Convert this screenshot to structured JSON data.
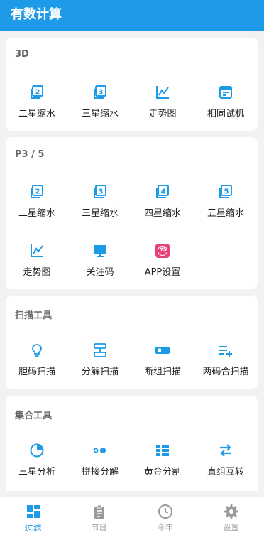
{
  "app": {
    "title": "有数计算"
  },
  "colors": {
    "accent": "#1e9be8",
    "pink": "#e9407a",
    "muted": "#999999"
  },
  "sections": [
    {
      "title": "3D",
      "items": [
        {
          "label": "二星缩水",
          "icon": "box-2-icon"
        },
        {
          "label": "三星缩水",
          "icon": "box-3-icon"
        },
        {
          "label": "走势图",
          "icon": "line-chart-icon"
        },
        {
          "label": "相同试机",
          "icon": "note-icon"
        }
      ]
    },
    {
      "title": "P3 / 5",
      "items": [
        {
          "label": "二星缩水",
          "icon": "box-2-icon"
        },
        {
          "label": "三星缩水",
          "icon": "box-3-icon"
        },
        {
          "label": "四星缩水",
          "icon": "box-4-icon"
        },
        {
          "label": "五星缩水",
          "icon": "box-5-icon"
        },
        {
          "label": "走势图",
          "icon": "line-chart-icon"
        },
        {
          "label": "关注码",
          "icon": "monitor-icon"
        },
        {
          "label": "APP设置",
          "icon": "ys-badge-icon",
          "badge": "YS"
        }
      ]
    },
    {
      "title": "扫描工具",
      "items": [
        {
          "label": "胆码扫描",
          "icon": "bulb-icon"
        },
        {
          "label": "分解扫描",
          "icon": "split-icon"
        },
        {
          "label": "断组扫描",
          "icon": "battery-icon"
        },
        {
          "label": "两码合扫描",
          "icon": "list-add-icon"
        }
      ]
    },
    {
      "title": "集合工具",
      "items": [
        {
          "label": "三星分析",
          "icon": "pie-icon"
        },
        {
          "label": "拼接分解",
          "icon": "dots-icon"
        },
        {
          "label": "黄金分割",
          "icon": "grid-list-icon"
        },
        {
          "label": "直组互转",
          "icon": "swap-icon"
        }
      ]
    }
  ],
  "tabs": [
    {
      "label": "过滤",
      "icon": "dashboard-icon",
      "active": true
    },
    {
      "label": "节日",
      "icon": "clipboard-icon",
      "active": false
    },
    {
      "label": "今年",
      "icon": "clock-icon",
      "active": false
    },
    {
      "label": "设置",
      "icon": "gear-icon",
      "active": false
    }
  ]
}
